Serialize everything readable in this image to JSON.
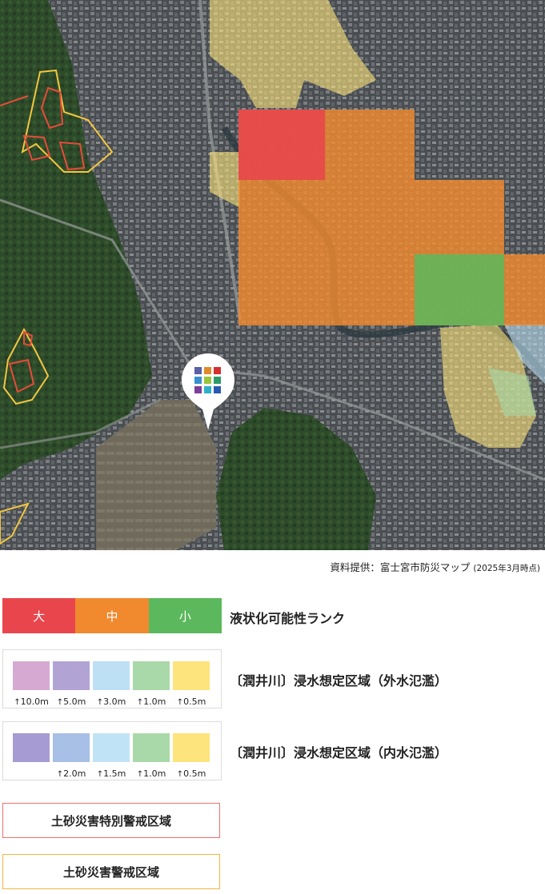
{
  "map": {
    "source_credit": "資料提供：富士宮市防災マップ",
    "source_date": "(2025年3月時点)",
    "marker_icon": "tile-grid-pin-icon"
  },
  "legend": {
    "liquefaction": {
      "title": "液状化可能性ランク",
      "levels": [
        {
          "label": "大",
          "color": "#e8464c"
        },
        {
          "label": "中",
          "color": "#f18a2f"
        },
        {
          "label": "小",
          "color": "#5cb85c"
        }
      ]
    },
    "external_flood": {
      "title": "〔潤井川〕浸水想定区域（外水氾濫）",
      "colors": [
        "#d6a9d2",
        "#b1a4d4",
        "#bde0f4",
        "#a9d8a9",
        "#fde47c"
      ],
      "depths": [
        "10.0m",
        "5.0m",
        "3.0m",
        "1.0m",
        "0.5m"
      ]
    },
    "internal_flood": {
      "title": "〔潤井川〕浸水想定区域（内水氾濫）",
      "colors": [
        "#a69bd2",
        "#a8bfe6",
        "#c1e3f6",
        "#a9d8a9",
        "#fde47c"
      ],
      "depths": [
        "",
        "2.0m",
        "1.5m",
        "1.0m",
        "0.5m"
      ]
    },
    "sediment_special": {
      "label": "土砂災害特別警戒区域",
      "border_color": "#e8726f"
    },
    "sediment_warning": {
      "label": "土砂災害警戒区域",
      "border_color": "#f2b63e"
    }
  }
}
